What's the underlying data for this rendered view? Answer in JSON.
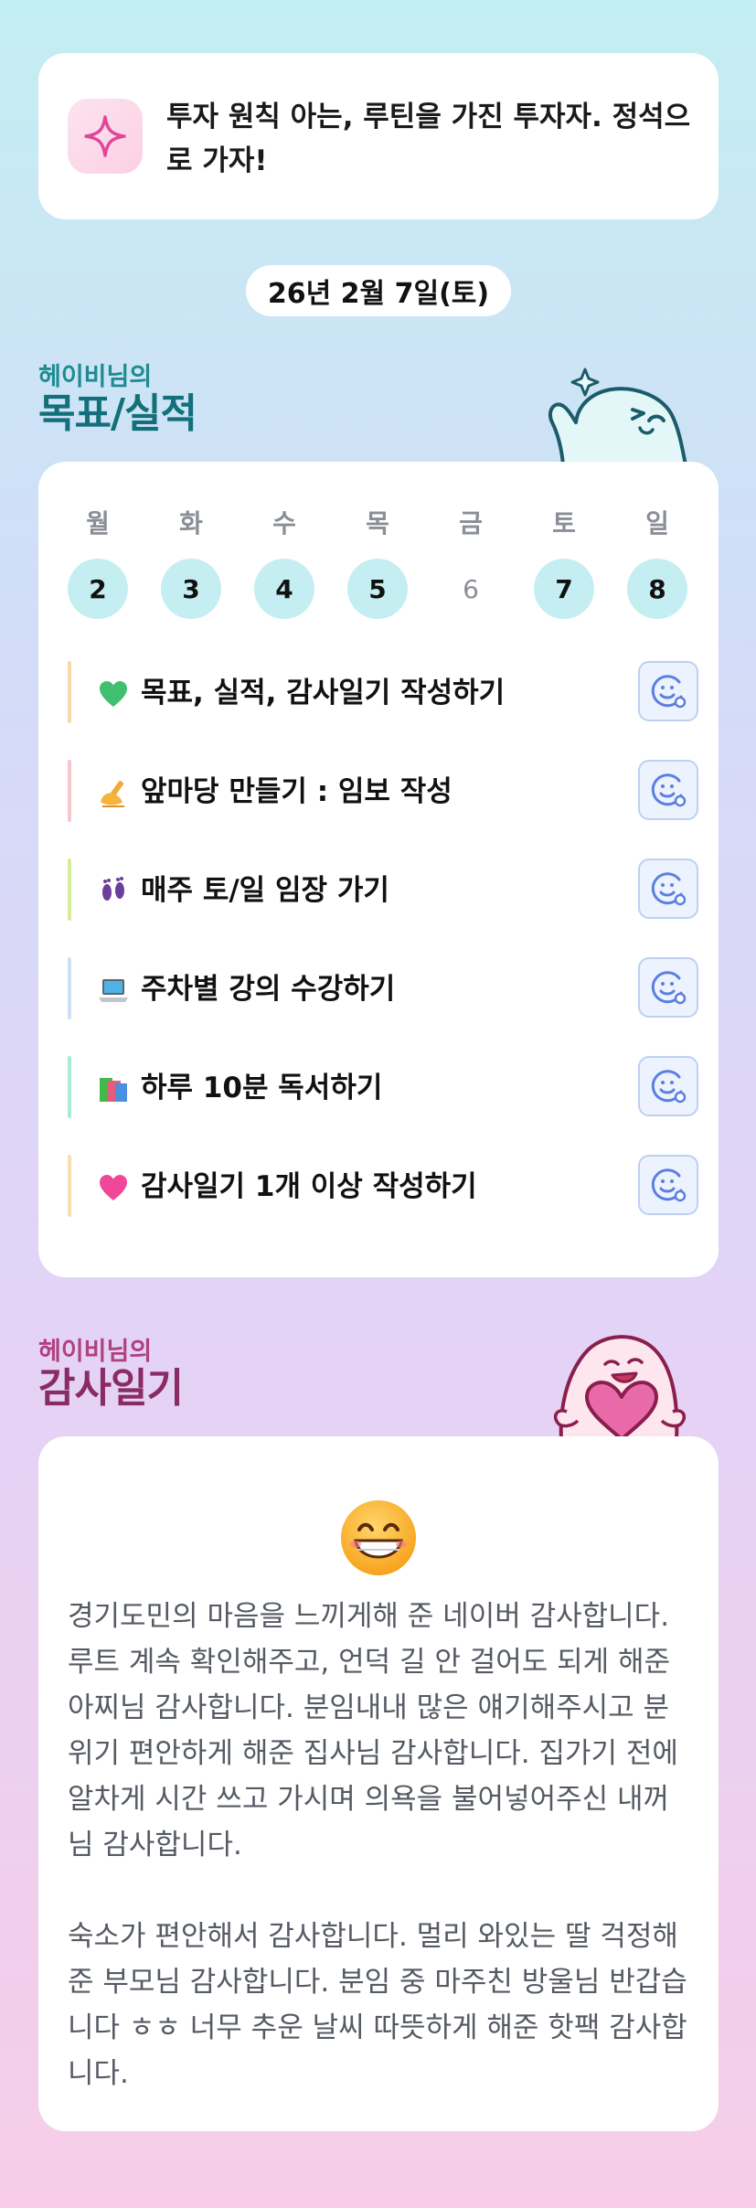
{
  "motto": {
    "icon": "sparkle-icon",
    "text": "투자 원칙 아는, 루틴을 가진 투자자. 정석으로 가자!"
  },
  "date_label": "26년 2월 7일(토)",
  "goals_section": {
    "subtitle": "헤이비님의",
    "title": "목표/실적",
    "week": [
      {
        "name": "월",
        "num": "2",
        "done": true
      },
      {
        "name": "화",
        "num": "3",
        "done": true
      },
      {
        "name": "수",
        "num": "4",
        "done": true
      },
      {
        "name": "목",
        "num": "5",
        "done": true
      },
      {
        "name": "금",
        "num": "6",
        "done": false
      },
      {
        "name": "토",
        "num": "7",
        "done": true
      },
      {
        "name": "일",
        "num": "8",
        "done": true
      }
    ],
    "goals": [
      {
        "icon": "green-heart-icon",
        "label": "목표, 실적, 감사일기 작성하기",
        "color": "#f6d9a8"
      },
      {
        "icon": "writing-hand-icon",
        "label": "앞마당 만들기 : 임보 작성",
        "color": "#f5c6cb"
      },
      {
        "icon": "footprints-icon",
        "label": "매주 토/일 임장 가기",
        "color": "#d5ec9a"
      },
      {
        "icon": "laptop-icon",
        "label": "주차별 강의 수강하기",
        "color": "#cfe0f5"
      },
      {
        "icon": "books-icon",
        "label": "하루 10분 독서하기",
        "color": "#a9ecd6"
      },
      {
        "icon": "pink-heart-icon",
        "label": "감사일기 1개 이상 작성하기",
        "color": "#f6e0b0"
      }
    ]
  },
  "gratitude_section": {
    "subtitle": "헤이비님의",
    "title": "감사일기",
    "emoji": "grinning-face-icon",
    "text": "경기도민의 마음을 느끼게해 준 네이버 감사합니다. 루트 계속 확인해주고, 언덕 길 안 걸어도 되게 해준 아찌님 감사합니다. 분임내내 많은 얘기해주시고 분위기 편안하게 해준 집사님 감사합니다. 집가기 전에 알차게 시간 쓰고 가시며 의욕을 불어넣어주신 내꺼님 감사합니다.\n\n숙소가 편안해서 감사합니다. 멀리 와있는 딸 걱정해준 부모님 감사합니다. 분임 중 마주친 방울님 반갑습니다 ㅎㅎ 너무 추운 날씨 따뜻하게 해준 핫팩 감사합니다."
  },
  "colors": {
    "accent_teal": "#1f8a92",
    "accent_plum": "#b0407e",
    "day_done": "#c5eef2",
    "react_button_border": "#bcd0f2",
    "react_icon": "#5b7fe0"
  }
}
